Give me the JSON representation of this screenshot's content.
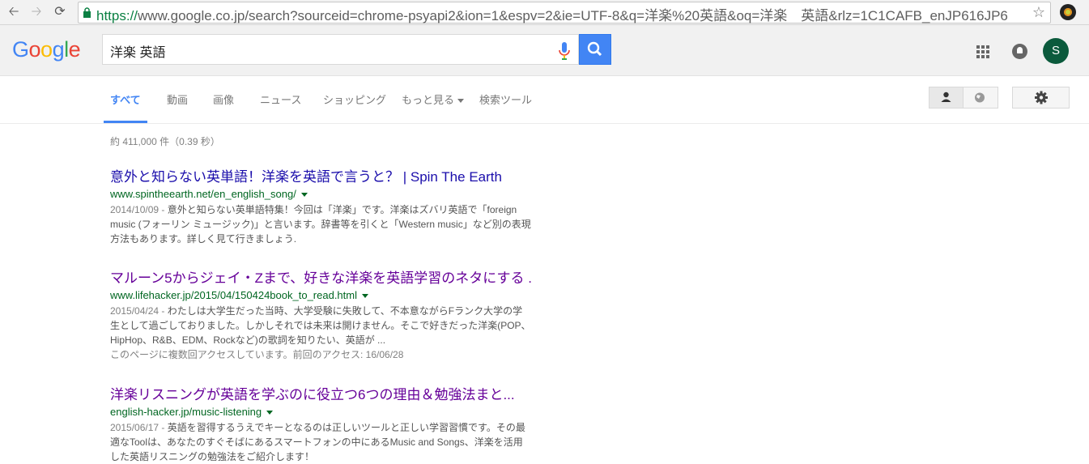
{
  "browser": {
    "url_scheme": "https://",
    "url_rest": "www.google.co.jp/search?sourceid=chrome-psyapi2&ion=1&espv=2&ie=UTF-8&q=洋楽%20英語&oq=洋楽　英語&rlz=1C1CAFB_enJP616JP6",
    "icons": [
      "back-icon",
      "forward-icon",
      "reload-icon",
      "lock-icon",
      "star-icon",
      "extension-icon"
    ]
  },
  "header": {
    "logo_letters": [
      "G",
      "o",
      "o",
      "g",
      "l",
      "e"
    ],
    "query": "洋楽 英語",
    "avatar_letter": "S"
  },
  "tabs": [
    {
      "label": "すべて",
      "active": true
    },
    {
      "label": "動画"
    },
    {
      "label": "画像"
    },
    {
      "label": "ニュース"
    },
    {
      "label": "ショッピング"
    },
    {
      "label": "もっと見る"
    },
    {
      "label": "検索ツール"
    }
  ],
  "stats": "約 411,000 件（0.39 秒）",
  "results": [
    {
      "title": "意外と知らない英単語！洋楽を英語で言うと？ | Spin The Earth",
      "url": "www.spintheearth.net/en_english_song/",
      "date": "2014/10/09 - ",
      "snippet": "意外と知らない英単語特集！今回は「洋楽」です。洋楽はズバリ英語で「foreign music (フォーリン ミュージック)」と言います。辞書等を引くと「Western music」など別の表現方法もあります。詳しく見て行きましょう.",
      "visited": false
    },
    {
      "title": "マルーン5からジェイ・Zまで、好きな洋楽を英語学習のネタにする ...",
      "url": "www.lifehacker.jp/2015/04/150424book_to_read.html",
      "date": "2015/04/24 - ",
      "snippet": "わたしは大学生だった当時、大学受験に失敗して、不本意ながらFランク大学の学生として過ごしておりました。しかしそれでは未来は開けません。そこで好きだった洋楽(POP、HipHop、R&B、EDM、Rockなど)の歌詞を知りたい、英語が ...",
      "visit_note": "このページに複数回アクセスしています。前回のアクセス: 16/06/28",
      "visited": true
    },
    {
      "title": "洋楽リスニングが英語を学ぶのに役立つ6つの理由＆勉強法まと...",
      "url": "english-hacker.jp/music-listening",
      "date": "2015/06/17 - ",
      "snippet": "英語を習得するうえでキーとなるのは正しいツールと正しい学習習慣です。その最適なToolは、あなたのすぐそばにあるスマートフォンの中にあるMusic and Songs、洋楽を活用した英語リスニングの勉強法をご紹介します！",
      "visited": true
    }
  ],
  "colors": {
    "link": "#1a0dab",
    "visited": "#660099",
    "url_green": "#006621",
    "accent": "#4285f4"
  }
}
